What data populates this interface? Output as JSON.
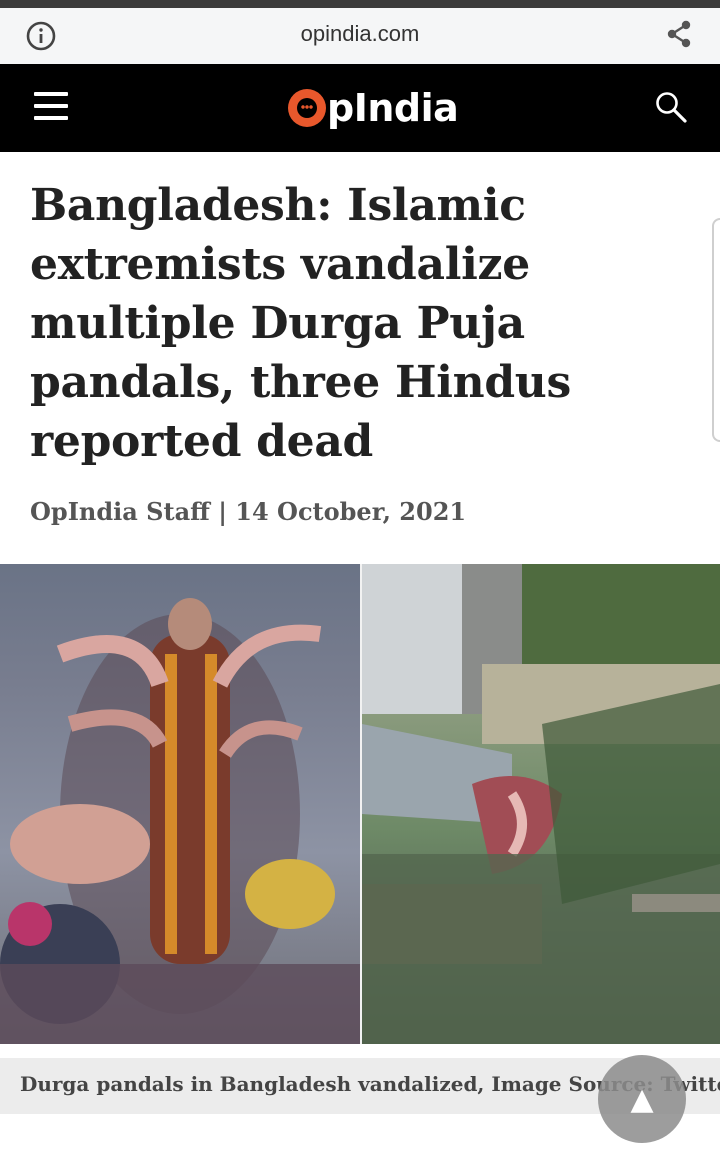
{
  "browser": {
    "url": "opindia.com",
    "info_icon": "info-icon",
    "share_icon": "share-icon"
  },
  "site": {
    "logo_text": "pIndia",
    "menu_icon": "hamburger-menu-icon",
    "search_icon": "search-icon",
    "brand_color": "#e8582c"
  },
  "article": {
    "headline": "Bangladesh: Islamic extremists vandalize multiple Durga Puja pandals, three Hindus reported dead",
    "byline": "OpIndia Staff | 14 October, 2021",
    "image_caption": "Durga pandals in Bangladesh vandalized, Image Source: Twitter"
  },
  "controls": {
    "scroll_top_icon": "▲"
  }
}
